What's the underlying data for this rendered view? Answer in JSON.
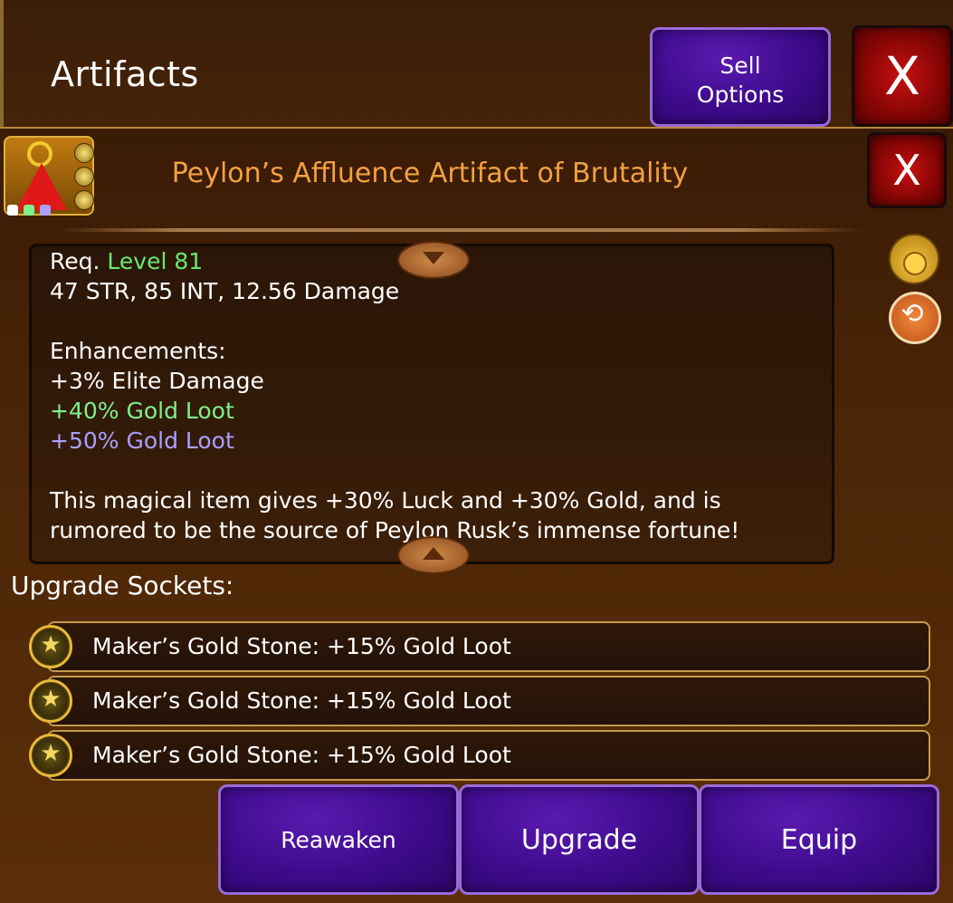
{
  "header": {
    "title": "Artifacts",
    "sell_options_line1": "Sell",
    "sell_options_line2": "Options",
    "close_label": "X"
  },
  "item": {
    "name": "Peylon’s Affluence Artifact of Brutality",
    "close_label": "X",
    "description": {
      "req_label": "Req.",
      "req_value": "Level 81",
      "stats": "47 STR, 85 INT, 12.56 Damage",
      "enhancements_heading": "Enhancements:",
      "enhancement_1": "+3% Elite Damage",
      "enhancement_2": "+40% Gold Loot",
      "enhancement_3": "+50% Gold Loot",
      "flavor_line1": "This magical item gives +30% Luck and +30% Gold, and is",
      "flavor_line2": "rumored to be the source of Peylon Rusk’s immense fortune!"
    }
  },
  "sockets": {
    "label": "Upgrade Sockets:",
    "items": [
      {
        "text": "Maker’s Gold Stone: +15% Gold Loot"
      },
      {
        "text": "Maker’s Gold Stone: +15% Gold Loot"
      },
      {
        "text": "Maker’s Gold Stone: +15% Gold Loot"
      }
    ]
  },
  "actions": {
    "reawaken": "Reawaken",
    "upgrade": "Upgrade",
    "equip": "Equip"
  },
  "icons": {
    "stone_glyph": "★",
    "cycle_glyph": "⟲"
  },
  "colors": {
    "item_name": "#f2a040",
    "level_green": "#6be86b",
    "enh_green": "#7ef08a",
    "enh_lavender": "#aaa0ff",
    "button_purple": "#3d0a8a",
    "button_red": "#8a0606"
  }
}
